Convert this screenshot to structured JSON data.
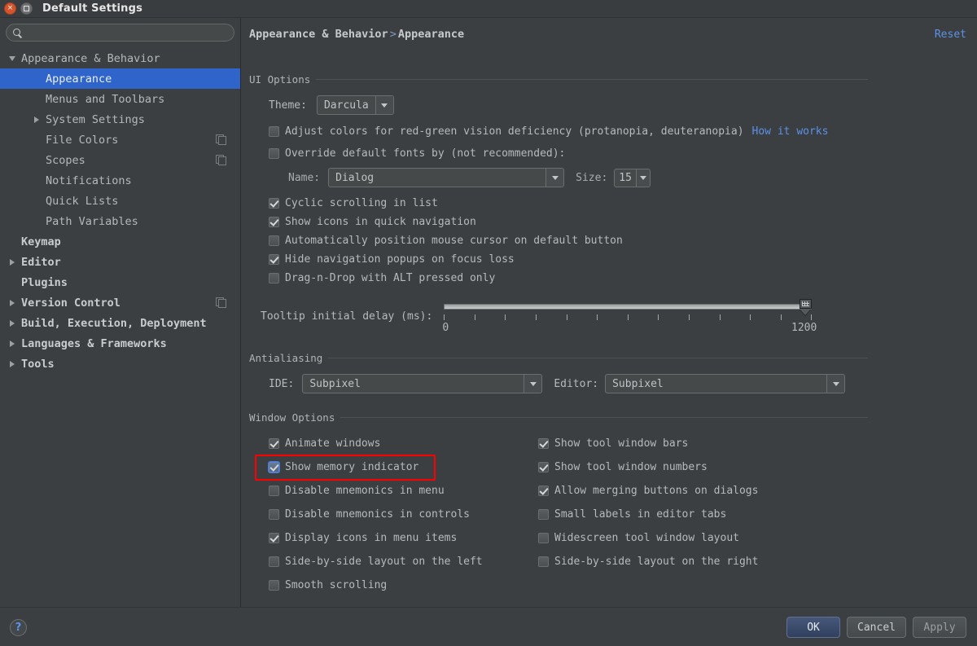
{
  "window": {
    "title": "Default Settings",
    "close_icon": "close-icon",
    "maximize_icon": "maximize-icon"
  },
  "search": {
    "value": "",
    "placeholder": "",
    "icon": "search-icon"
  },
  "sidebar": {
    "items": [
      {
        "label": "Appearance & Behavior",
        "level": 0,
        "arrow": "down",
        "selected": false,
        "bold": false,
        "copy": false
      },
      {
        "label": "Appearance",
        "level": 1,
        "arrow": "none",
        "selected": true,
        "bold": false,
        "copy": false
      },
      {
        "label": "Menus and Toolbars",
        "level": 1,
        "arrow": "none",
        "selected": false,
        "bold": false,
        "copy": false
      },
      {
        "label": "System Settings",
        "level": 1,
        "arrow": "right",
        "selected": false,
        "bold": false,
        "copy": false
      },
      {
        "label": "File Colors",
        "level": 1,
        "arrow": "none",
        "selected": false,
        "bold": false,
        "copy": true
      },
      {
        "label": "Scopes",
        "level": 1,
        "arrow": "none",
        "selected": false,
        "bold": false,
        "copy": true
      },
      {
        "label": "Notifications",
        "level": 1,
        "arrow": "none",
        "selected": false,
        "bold": false,
        "copy": false
      },
      {
        "label": "Quick Lists",
        "level": 1,
        "arrow": "none",
        "selected": false,
        "bold": false,
        "copy": false
      },
      {
        "label": "Path Variables",
        "level": 1,
        "arrow": "none",
        "selected": false,
        "bold": false,
        "copy": false
      },
      {
        "label": "Keymap",
        "level": 0,
        "arrow": "none",
        "selected": false,
        "bold": true,
        "copy": false
      },
      {
        "label": "Editor",
        "level": 0,
        "arrow": "right",
        "selected": false,
        "bold": true,
        "copy": false
      },
      {
        "label": "Plugins",
        "level": 0,
        "arrow": "none",
        "selected": false,
        "bold": true,
        "copy": false
      },
      {
        "label": "Version Control",
        "level": 0,
        "arrow": "right",
        "selected": false,
        "bold": true,
        "copy": true
      },
      {
        "label": "Build, Execution, Deployment",
        "level": 0,
        "arrow": "right",
        "selected": false,
        "bold": true,
        "copy": false
      },
      {
        "label": "Languages & Frameworks",
        "level": 0,
        "arrow": "right",
        "selected": false,
        "bold": true,
        "copy": false
      },
      {
        "label": "Tools",
        "level": 0,
        "arrow": "right",
        "selected": false,
        "bold": true,
        "copy": false
      }
    ]
  },
  "main": {
    "breadcrumb": {
      "parent": "Appearance & Behavior",
      "separator": ">",
      "current": "Appearance"
    },
    "reset_label": "Reset",
    "ui_options": {
      "title": "UI Options",
      "theme_label": "Theme:",
      "theme_value": "Darcula",
      "adjust_colors": {
        "label": "Adjust colors for red-green vision deficiency (protanopia, deuteranopia)",
        "checked": false
      },
      "how_it_works_link": "How it works",
      "override_fonts": {
        "label": "Override default fonts by (not recommended):",
        "checked": false
      },
      "font_name_label": "Name:",
      "font_name_value": "Dialog",
      "font_size_label": "Size:",
      "font_size_value": "15",
      "checkboxes": [
        {
          "label": "Cyclic scrolling in list",
          "checked": true
        },
        {
          "label": "Show icons in quick navigation",
          "checked": true
        },
        {
          "label": "Automatically position mouse cursor on default button",
          "checked": false
        },
        {
          "label": "Hide navigation popups on focus loss",
          "checked": true
        },
        {
          "label": "Drag-n-Drop with ALT pressed only",
          "checked": false
        }
      ],
      "tooltip_delay": {
        "label": "Tooltip initial delay (ms):",
        "min_label": "0",
        "max_label": "1200",
        "min": 0,
        "max": 1200,
        "value": 1200,
        "tick_count": 13
      }
    },
    "antialiasing": {
      "title": "Antialiasing",
      "ide_label": "IDE:",
      "ide_value": "Subpixel",
      "editor_label": "Editor:",
      "editor_value": "Subpixel"
    },
    "window_options": {
      "title": "Window Options",
      "left_column": [
        {
          "label": "Animate windows",
          "checked": true,
          "focused": false,
          "highlighted": false
        },
        {
          "label": "Show memory indicator",
          "checked": true,
          "focused": true,
          "highlighted": true
        },
        {
          "label": "Disable mnemonics in menu",
          "checked": false,
          "focused": false,
          "highlighted": false
        },
        {
          "label": "Disable mnemonics in controls",
          "checked": false,
          "focused": false,
          "highlighted": false
        },
        {
          "label": "Display icons in menu items",
          "checked": true,
          "focused": false,
          "highlighted": false
        },
        {
          "label": "Side-by-side layout on the left",
          "checked": false,
          "focused": false,
          "highlighted": false
        },
        {
          "label": "Smooth scrolling",
          "checked": false,
          "focused": false,
          "highlighted": false
        }
      ],
      "right_column": [
        {
          "label": "Show tool window bars",
          "checked": true
        },
        {
          "label": "Show tool window numbers",
          "checked": true
        },
        {
          "label": "Allow merging buttons on dialogs",
          "checked": true
        },
        {
          "label": "Small labels in editor tabs",
          "checked": false
        },
        {
          "label": "Widescreen tool window layout",
          "checked": false
        },
        {
          "label": "Side-by-side layout on the right",
          "checked": false
        }
      ]
    }
  },
  "footer": {
    "help_label": "?",
    "buttons": [
      {
        "label": "OK",
        "primary": true
      },
      {
        "label": "Cancel",
        "primary": false
      },
      {
        "label": "Apply",
        "primary": false,
        "dim": true
      }
    ]
  },
  "colors": {
    "background": "#3c3f41",
    "selection": "#2f65ca",
    "link": "#5c92e8",
    "highlight_box": "#ff0000",
    "text": "#b6babd"
  }
}
